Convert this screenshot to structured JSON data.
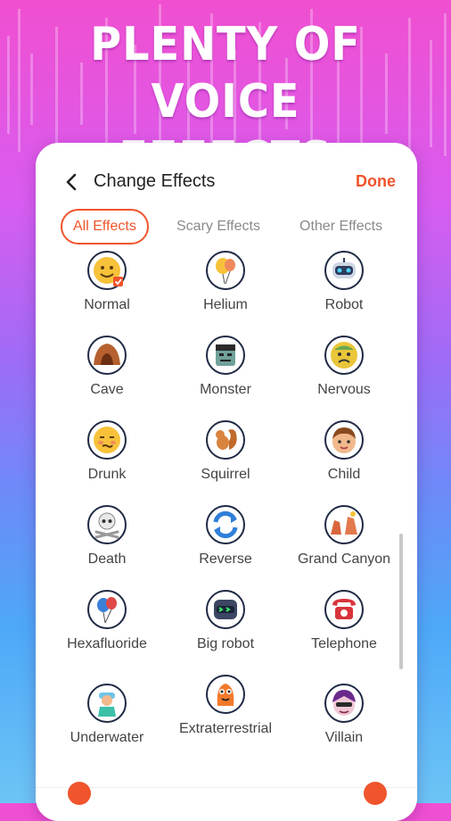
{
  "headline": {
    "line1": "PLENTY OF VOICE",
    "line2": "EFFECTS"
  },
  "header": {
    "title": "Change Effects",
    "done_label": "Done"
  },
  "tabs": [
    {
      "label": "All Effects",
      "active": true
    },
    {
      "label": "Scary Effects",
      "active": false
    },
    {
      "label": "Other Effects",
      "active": false
    }
  ],
  "effects": [
    {
      "label": "Normal",
      "icon": "smiley-face-icon",
      "selected": true
    },
    {
      "label": "Helium",
      "icon": "balloon-icon"
    },
    {
      "label": "Robot",
      "icon": "robot-head-icon"
    },
    {
      "label": "Cave",
      "icon": "cave-icon"
    },
    {
      "label": "Monster",
      "icon": "frankenstein-icon"
    },
    {
      "label": "Nervous",
      "icon": "nervous-face-icon"
    },
    {
      "label": "Drunk",
      "icon": "drunk-face-icon"
    },
    {
      "label": "Squirrel",
      "icon": "squirrel-icon"
    },
    {
      "label": "Child",
      "icon": "child-face-icon"
    },
    {
      "label": "Death",
      "icon": "skull-crossbones-icon"
    },
    {
      "label": "Reverse",
      "icon": "reverse-arrows-icon"
    },
    {
      "label": "Grand Canyon",
      "icon": "canyon-icon"
    },
    {
      "label": "Hexafluoride",
      "icon": "party-balloons-icon"
    },
    {
      "label": "Big robot",
      "icon": "big-robot-icon"
    },
    {
      "label": "Telephone",
      "icon": "telephone-icon"
    },
    {
      "label": "Underwater",
      "icon": "diver-icon"
    },
    {
      "label": "Extraterrestrial",
      "icon": "alien-icon"
    },
    {
      "label": "Villain",
      "icon": "villain-face-icon"
    }
  ],
  "colors": {
    "accent": "#f0542c",
    "text": "#444444",
    "icon_ring": "#1f2a44"
  }
}
